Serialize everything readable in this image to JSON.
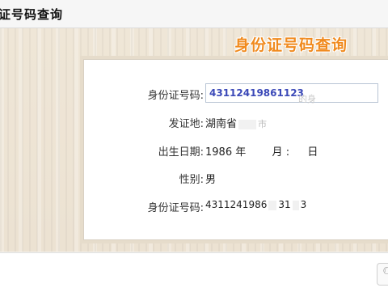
{
  "header": {
    "title": "证号码查询"
  },
  "banner": {
    "text": "身份证号码查询"
  },
  "form": {
    "id_label": "身份证号码:",
    "id_input_value": "43112419861123",
    "id_input_ghost": "的身",
    "origin_label": "发证地:",
    "origin_value": "湖南省",
    "origin_fragment": "市",
    "birth_label": "出生日期:",
    "birth_year": "1986",
    "birth_year_unit": "年",
    "birth_month_unit": "月",
    "birth_sep": ":",
    "birth_day_unit": "日",
    "gender_label": "性别:",
    "gender_value": "男",
    "result_id_label": "身份证号码:",
    "result_id_value": "4311241986",
    "result_id_tail_a": "31",
    "result_id_tail_b": "3"
  },
  "bottombar": {
    "search_icon": "search-icon"
  }
}
